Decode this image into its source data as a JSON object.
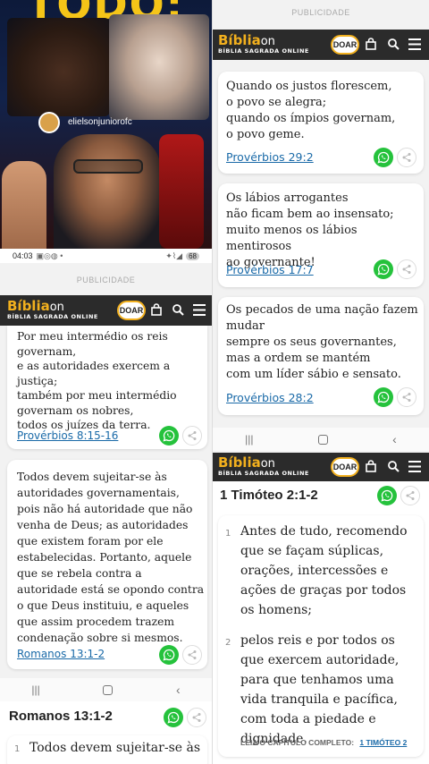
{
  "video": {
    "top_text": "TODO:",
    "handle": "elielsonjuniorofc"
  },
  "status_bar": {
    "time": "04:03",
    "battery": "68"
  },
  "publicidade": "PUBLICIDADE",
  "brand": {
    "logo_main": "Bíblia",
    "logo_on": "on",
    "logo_sub": "BÍBLIA SAGRADA ONLINE",
    "doar": "DOAR"
  },
  "left": {
    "card1": {
      "text": "Por meu intermédio os reis governam,\ne as autoridades exercem a justiça;\ntambém por meu intermédio governam os nobres,\ntodos os juízes da terra.",
      "ref": "Provérbios 8:15-16"
    },
    "card2": {
      "text": "Todos devem sujeitar-se às autoridades governamentais, pois não há autoridade que não venha de Deus; as autoridades que existem foram por ele estabelecidas. Portanto, aquele que se rebela contra a autoridade está se opondo contra o que Deus instituiu, e aqueles que assim procedem trazem condenação sobre si mesmos.",
      "ref": "Romanos 13:1-2"
    },
    "chapter_title": "Romanos 13:1-2",
    "verse1_num": "1",
    "verse1_text": "Todos devem sujeitar-se às"
  },
  "right": {
    "card1": {
      "text": "Quando os justos florescem,\no povo se alegra;\nquando os ímpios governam,\no povo geme.",
      "ref": "Provérbios 29:2"
    },
    "card2": {
      "text": "Os lábios arrogantes\nnão ficam bem ao insensato;\nmuito menos os lábios mentirosos\nao governante!",
      "ref": "Provérbios 17:7"
    },
    "card3": {
      "text": "Os pecados de uma nação fazem mudar\nsempre os seus governantes,\nmas a ordem se mantém\ncom um líder sábio e sensato.",
      "ref": "Provérbios 28:2"
    },
    "chapter_title": "1 Timóteo 2:1-2",
    "verse1_num": "1",
    "verse1_text": "Antes de tudo, recomendo que se façam súplicas, orações, intercessões e ações de graças por todos os homens;",
    "verse2_num": "2",
    "verse2_text": "pelos reis e por todos os que exercem autoridade, para que tenhamos uma vida tranquila e pacífica, com toda a piedade e dignidade.",
    "read_label": "LEIA O CAPÍTULO COMPLETO:",
    "read_link": "1 TIMÓTEO 2"
  },
  "colors": {
    "brand_gold": "#f2b01e",
    "header_dark": "#2b2b2b",
    "link_blue": "#1a6aa8",
    "whatsapp_green": "#25c23c"
  },
  "icons": [
    "bag-icon",
    "search-icon",
    "menu-icon",
    "whatsapp-icon",
    "share-icon",
    "recents-icon",
    "home-icon",
    "back-icon"
  ]
}
